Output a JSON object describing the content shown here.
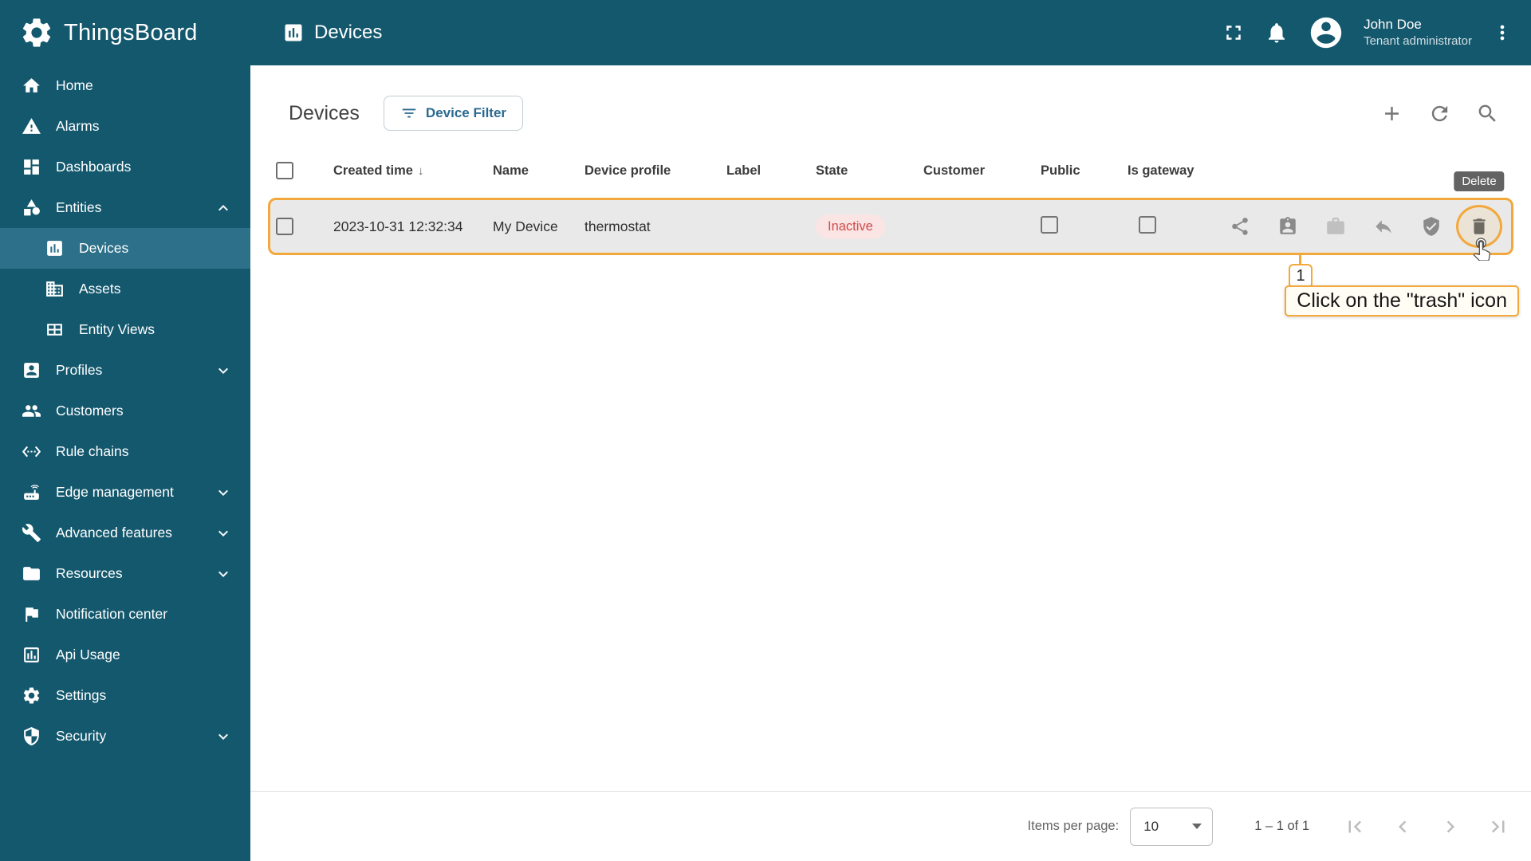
{
  "app": {
    "name": "ThingsBoard"
  },
  "topbar": {
    "title": "Devices",
    "user_name": "John Doe",
    "user_role": "Tenant administrator"
  },
  "sidebar": {
    "items": [
      {
        "label": "Home"
      },
      {
        "label": "Alarms"
      },
      {
        "label": "Dashboards"
      },
      {
        "label": "Entities"
      },
      {
        "label": "Devices"
      },
      {
        "label": "Assets"
      },
      {
        "label": "Entity Views"
      },
      {
        "label": "Profiles"
      },
      {
        "label": "Customers"
      },
      {
        "label": "Rule chains"
      },
      {
        "label": "Edge management"
      },
      {
        "label": "Advanced features"
      },
      {
        "label": "Resources"
      },
      {
        "label": "Notification center"
      },
      {
        "label": "Api Usage"
      },
      {
        "label": "Settings"
      },
      {
        "label": "Security"
      }
    ]
  },
  "content": {
    "heading": "Devices",
    "filter_button_label": "Device Filter",
    "table": {
      "headers": {
        "created_time": "Created time",
        "name": "Name",
        "device_profile": "Device profile",
        "label": "Label",
        "state": "State",
        "customer": "Customer",
        "public": "Public",
        "is_gateway": "Is gateway"
      },
      "rows": [
        {
          "created_time": "2023-10-31 12:32:34",
          "name": "My Device",
          "device_profile": "thermostat",
          "label": "",
          "state": "Inactive",
          "customer": ""
        }
      ]
    },
    "pagination": {
      "items_per_page_label": "Items per page:",
      "items_per_page_value": "10",
      "range": "1 – 1 of 1"
    }
  },
  "tutorial": {
    "step_number": "1",
    "callout_text": "Click on the \"trash\" icon",
    "tooltip": "Delete"
  },
  "colors": {
    "primary": "#14586e",
    "accent": "#f3a83b",
    "inactive_text": "#d14a4a",
    "inactive_bg": "#fbe4e4"
  }
}
